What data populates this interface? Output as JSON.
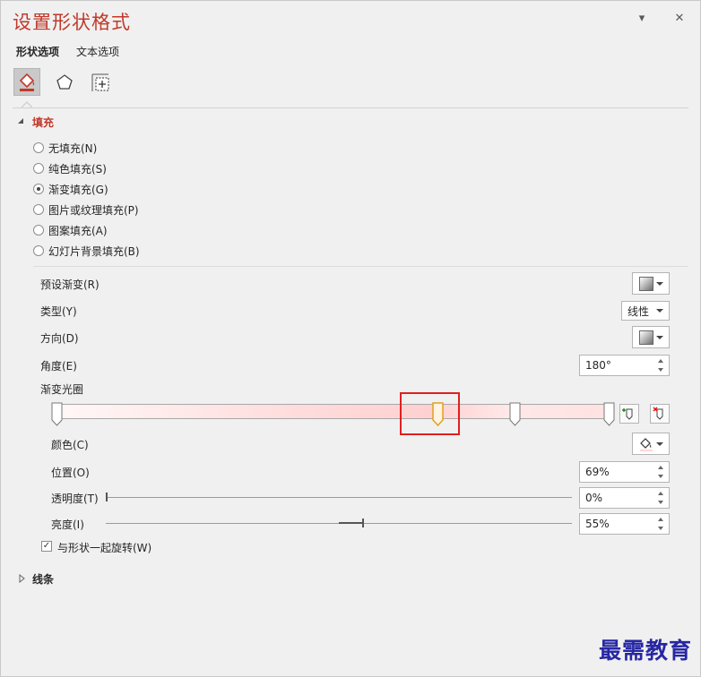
{
  "title": "设置形状格式",
  "title_buttons": {
    "dropdown_glyph": "▾",
    "close_glyph": "✕"
  },
  "tabs": [
    {
      "label": "形状选项",
      "active": true
    },
    {
      "label": "文本选项",
      "active": false
    }
  ],
  "icon_tabs": [
    {
      "name": "fill-line-icon",
      "active": true
    },
    {
      "name": "effects-pentagon-icon",
      "active": false
    },
    {
      "name": "size-properties-icon",
      "active": false
    }
  ],
  "fill_section": {
    "header": "填充",
    "expanded": true,
    "options": [
      {
        "label": "无填充(N)",
        "checked": false
      },
      {
        "label": "纯色填充(S)",
        "checked": false
      },
      {
        "label": "渐变填充(G)",
        "checked": true
      },
      {
        "label": "图片或纹理填充(P)",
        "checked": false
      },
      {
        "label": "图案填充(A)",
        "checked": false
      },
      {
        "label": "幻灯片背景填充(B)",
        "checked": false
      }
    ],
    "preset_gradient_label": "预设渐变(R)",
    "type_label": "类型(Y)",
    "type_value": "线性",
    "direction_label": "方向(D)",
    "angle_label": "角度(E)",
    "angle_value": "180°",
    "gradient_stops_label": "渐变光圈",
    "gradient_stops": [
      {
        "position": 0,
        "selected": false
      },
      {
        "position": 69,
        "selected": true
      },
      {
        "position": 83,
        "selected": false
      },
      {
        "position": 100,
        "selected": false
      }
    ],
    "highlight_color": "#e02020",
    "color_label": "颜色(C)",
    "position_label": "位置(O)",
    "position_value": "69%",
    "transparency_label": "透明度(T)",
    "transparency_value": "0%",
    "transparency_level": 0,
    "brightness_label": "亮度(I)",
    "brightness_value": "55%",
    "brightness_level": 55,
    "rotate_with_shape_label": "与形状一起旋转(W)",
    "rotate_with_shape_checked": true
  },
  "line_section": {
    "header": "线条",
    "expanded": false
  },
  "accent_color": "#c0392b",
  "watermark": "最需教育"
}
